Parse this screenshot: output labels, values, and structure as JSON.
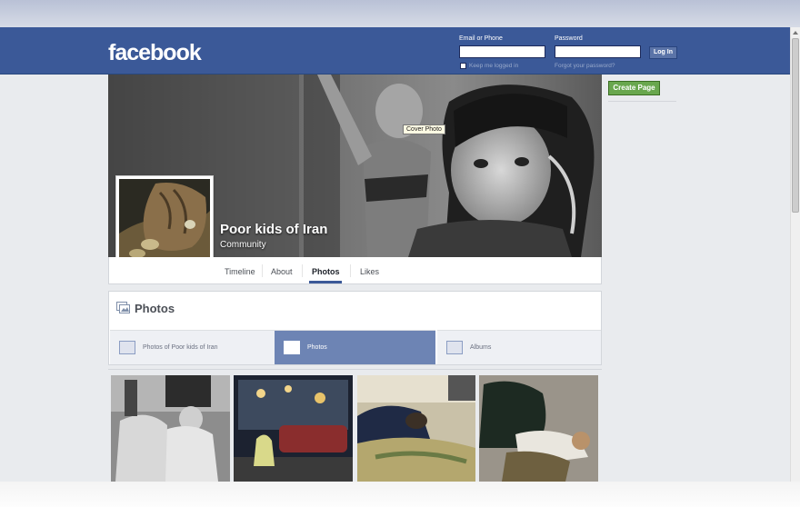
{
  "header": {
    "logo": "facebook",
    "email_label": "Email or Phone",
    "password_label": "Password",
    "login_button": "Log In",
    "keep_logged_in": "Keep me logged in",
    "forgot_password": "Forgot your password?"
  },
  "cover": {
    "tooltip": "Cover Photo"
  },
  "page": {
    "name": "Poor kids of Iran",
    "category": "Community"
  },
  "nav": {
    "tabs": [
      "Timeline",
      "About",
      "Photos",
      "Likes"
    ],
    "active": "Photos"
  },
  "photos": {
    "title": "Photos",
    "subtabs": [
      "Photos of Poor kids of Iran",
      "Photos",
      "Albums"
    ],
    "active_subtab": "Photos"
  },
  "sidebar": {
    "create_page": "Create Page"
  },
  "colors": {
    "brand_blue": "#3b5998",
    "create_green": "#69a74e",
    "active_subtab": "#6d84b4"
  }
}
